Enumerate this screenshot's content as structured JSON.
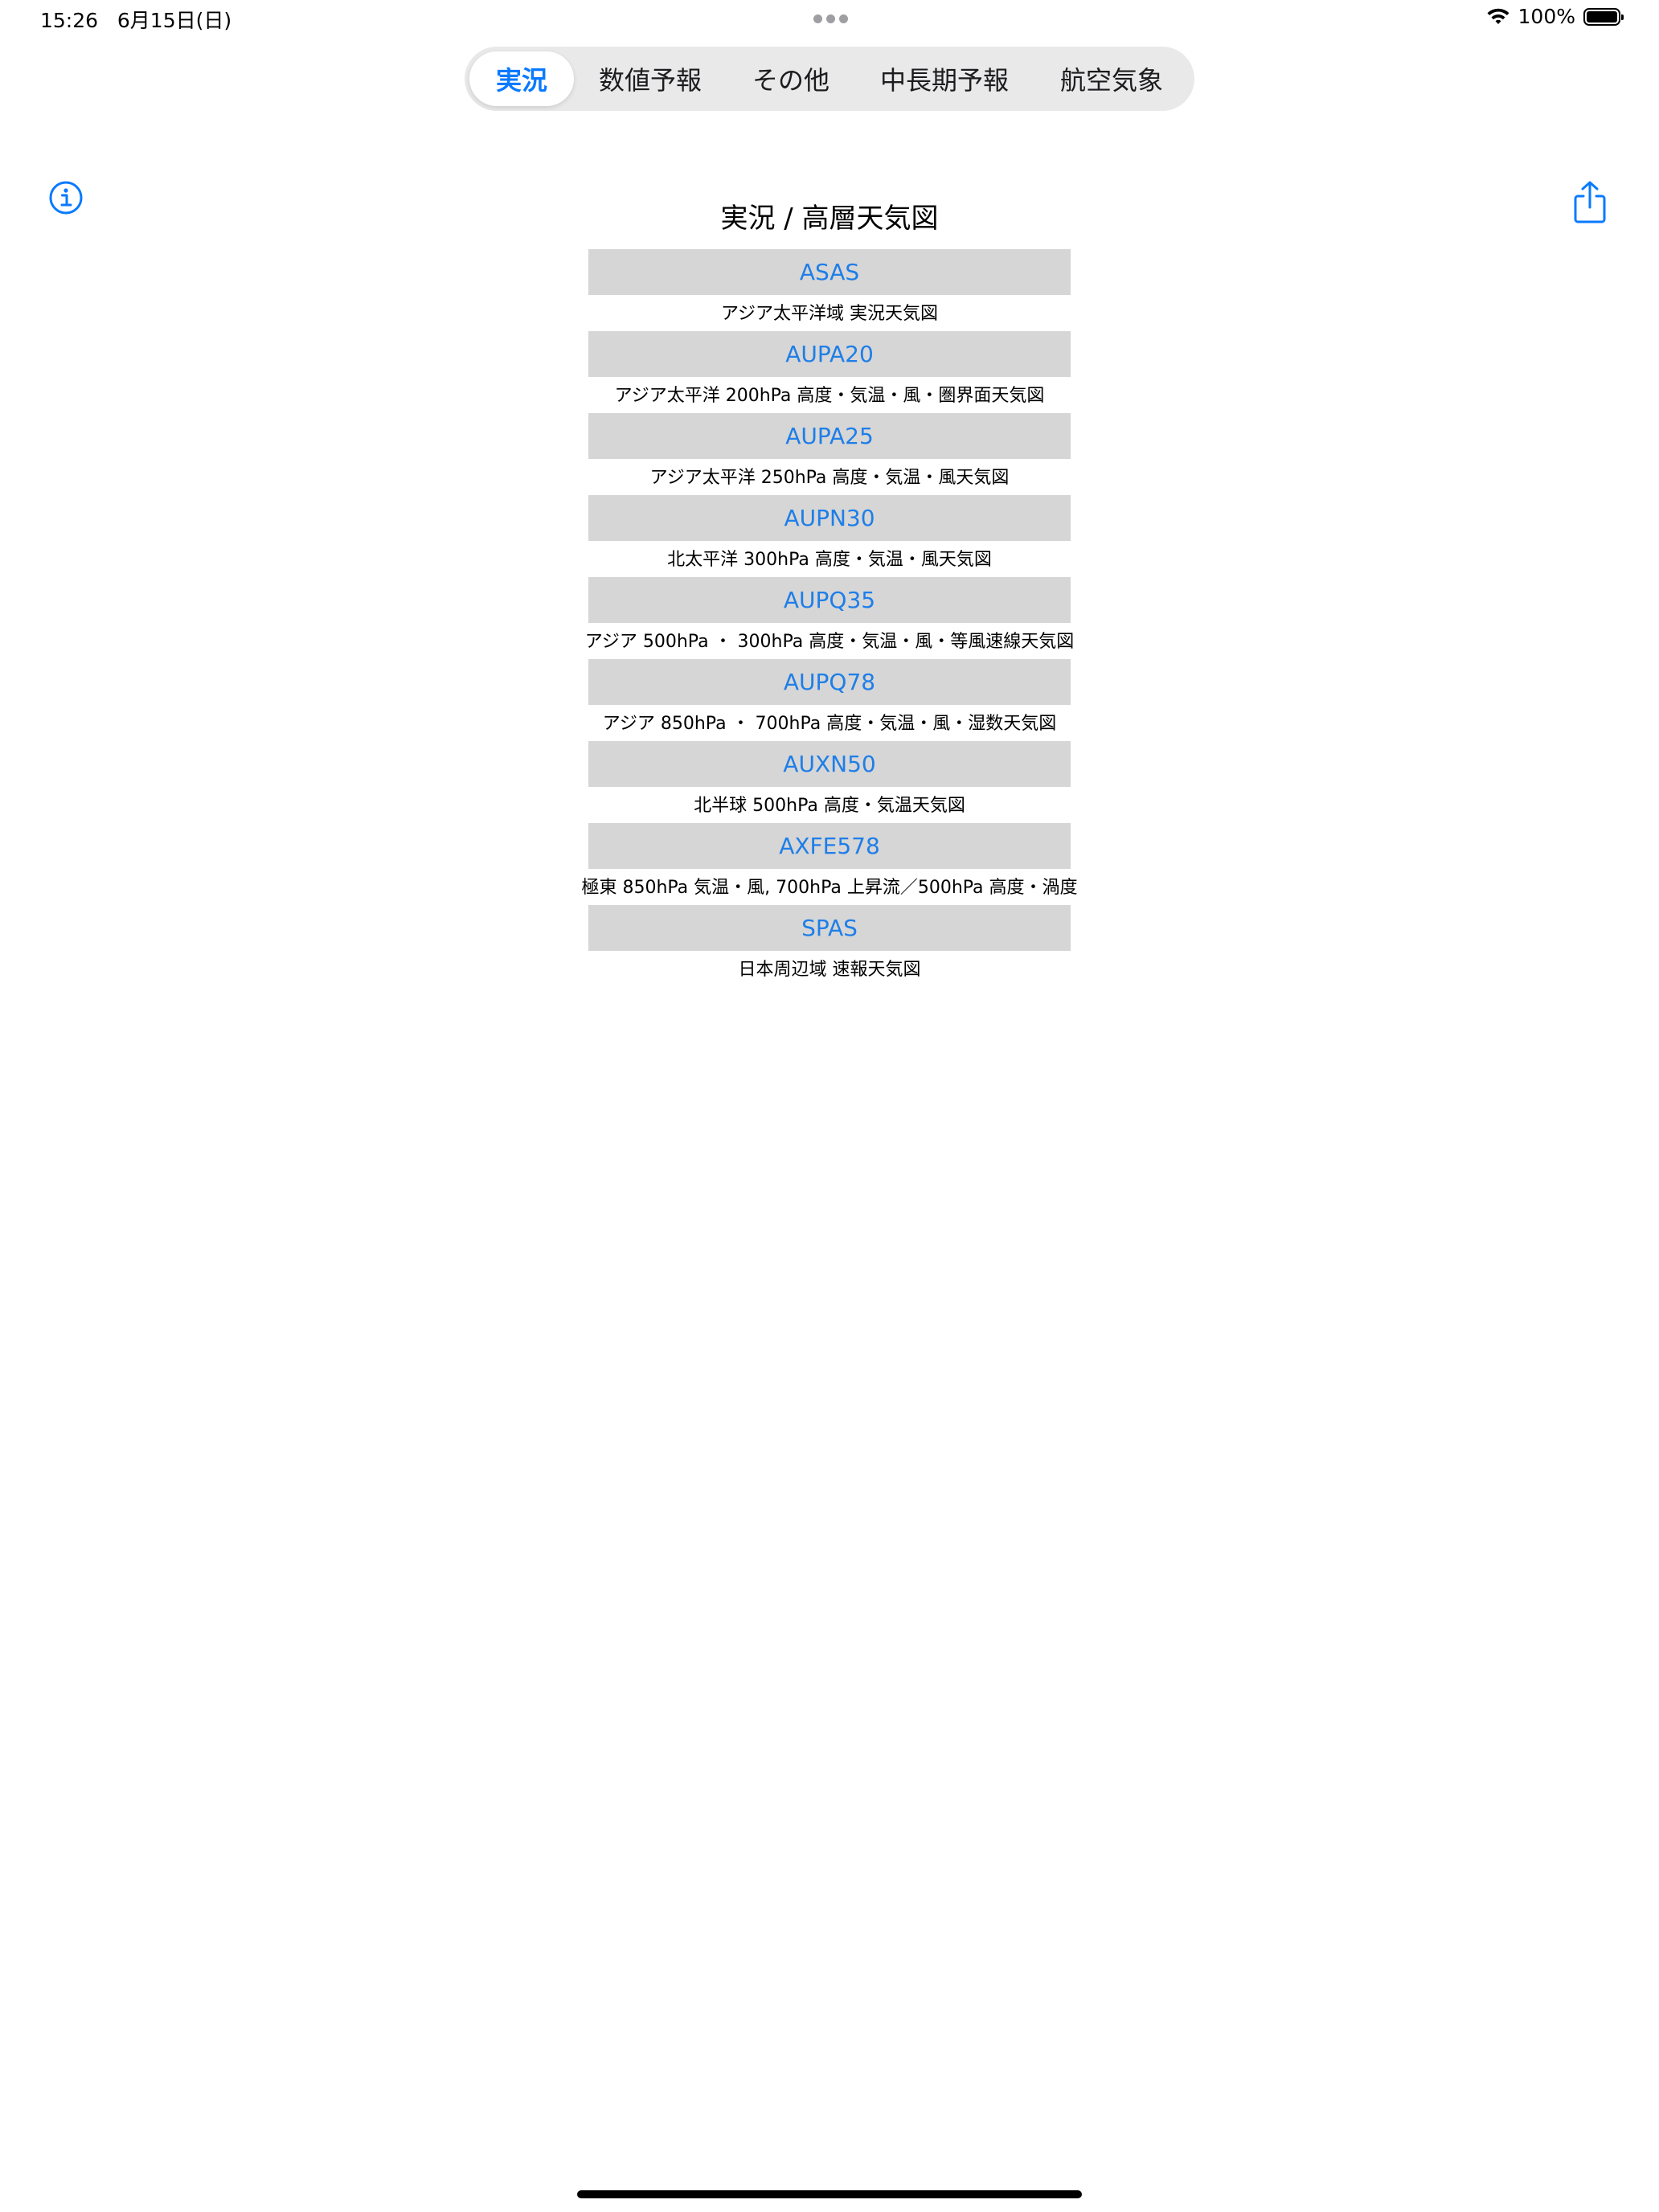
{
  "status_bar": {
    "time": "15:26",
    "date": "6月15日(日)",
    "battery_percent": "100%",
    "battery_level": 1.0
  },
  "segments": {
    "selected_index": 0,
    "items": [
      {
        "label": "実況"
      },
      {
        "label": "数値予報"
      },
      {
        "label": "その他"
      },
      {
        "label": "中長期予報"
      },
      {
        "label": "航空気象"
      }
    ]
  },
  "icons": {
    "info": "info-circle-icon",
    "share": "share-icon",
    "wifi": "wifi-icon",
    "battery": "battery-icon"
  },
  "colors": {
    "accent": "#0a7aff",
    "link": "#1e7ee8",
    "item_background": "#d6d6d6"
  },
  "page": {
    "title": "実況 / 高層天気図"
  },
  "charts": [
    {
      "code": "ASAS",
      "description": "アジア太平洋域 実況天気図"
    },
    {
      "code": "AUPA20",
      "description": "アジア太平洋 200hPa 高度・気温・風・圏界面天気図"
    },
    {
      "code": "AUPA25",
      "description": "アジア太平洋 250hPa 高度・気温・風天気図"
    },
    {
      "code": "AUPN30",
      "description": "北太平洋 300hPa 高度・気温・風天気図"
    },
    {
      "code": "AUPQ35",
      "description": "アジア 500hPa ・ 300hPa 高度・気温・風・等風速線天気図"
    },
    {
      "code": "AUPQ78",
      "description": "アジア 850hPa ・ 700hPa 高度・気温・風・湿数天気図"
    },
    {
      "code": "AUXN50",
      "description": "北半球 500hPa 高度・気温天気図"
    },
    {
      "code": "AXFE578",
      "description": "極東 850hPa 気温・風, 700hPa 上昇流／500hPa 高度・渦度"
    },
    {
      "code": "SPAS",
      "description": "日本周辺域 速報天気図"
    }
  ]
}
